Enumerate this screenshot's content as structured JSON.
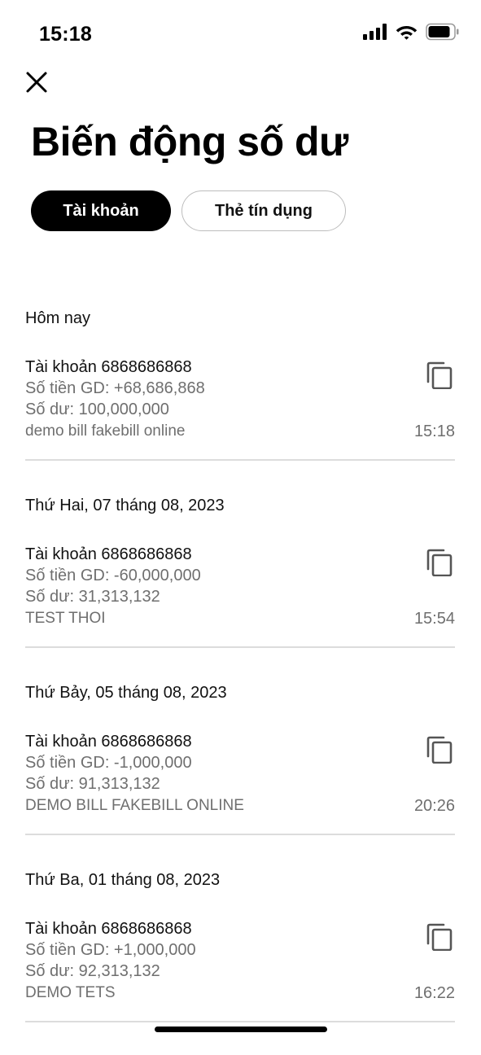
{
  "status_bar": {
    "time": "15:18",
    "icons": [
      "signal-icon",
      "wifi-icon",
      "battery-icon"
    ]
  },
  "header": {
    "close_icon": "close-icon",
    "title": "Biến động số dư"
  },
  "tabs": [
    {
      "label": "Tài khoản",
      "active": true
    },
    {
      "label": "Thẻ tín dụng",
      "active": false
    }
  ],
  "groups": [
    {
      "date": "Hôm nay",
      "transaction": {
        "account": "Tài khoản 6868686868",
        "amount": "Số tiền GD: +68,686,868",
        "balance": "Số dư: 100,000,000",
        "description": "demo bill fakebill online",
        "time": "15:18"
      }
    },
    {
      "date": "Thứ Hai, 07 tháng 08, 2023",
      "transaction": {
        "account": "Tài khoản 6868686868",
        "amount": "Số tiền GD: -60,000,000",
        "balance": "Số dư: 31,313,132",
        "description": "TEST THOI",
        "time": "15:54"
      }
    },
    {
      "date": "Thứ Bảy, 05 tháng 08, 2023",
      "transaction": {
        "account": "Tài khoản 6868686868",
        "amount": "Số tiền GD: -1,000,000",
        "balance": "Số dư: 91,313,132",
        "description": "DEMO BILL FAKEBILL ONLINE",
        "time": "20:26"
      }
    },
    {
      "date": "Thứ Ba, 01 tháng 08, 2023",
      "transaction": {
        "account": "Tài khoản 6868686868",
        "amount": "Số tiền GD: +1,000,000",
        "balance": "Số dư: 92,313,132",
        "description": "DEMO TETS",
        "time": "16:22"
      }
    }
  ],
  "colors": {
    "active_tab_bg": "#000000",
    "secondary_text": "#6f6f6f",
    "divider": "#dcdcdc"
  }
}
